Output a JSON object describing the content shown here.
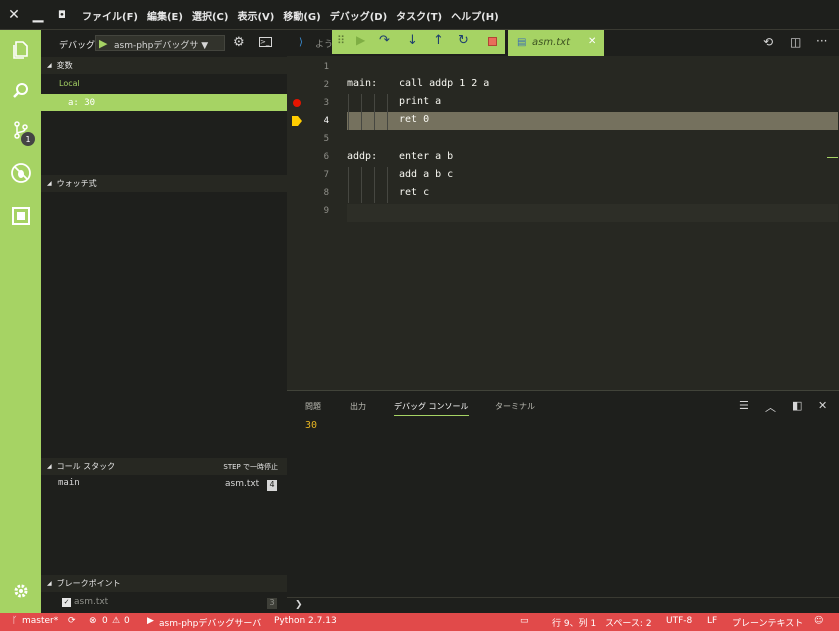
{
  "menu": [
    "ファイル(F)",
    "編集(E)",
    "選択(C)",
    "表示(V)",
    "移動(G)",
    "デバッグ(D)",
    "タスク(T)",
    "ヘルプ(H)"
  ],
  "activity": {
    "scm_badge": "1"
  },
  "debug_toolbar": {
    "label": "デバッグ",
    "config": "asm-phpデバッグサ ▼"
  },
  "variables": {
    "title": "変数",
    "scope": "Local",
    "items": [
      {
        "text": "a: 30"
      }
    ]
  },
  "watch": {
    "title": "ウォッチ式"
  },
  "callstack": {
    "title": "コール スタック",
    "status": "STEP で一時停止",
    "frame": {
      "name": "main",
      "file": "asm.txt",
      "line": "4"
    }
  },
  "breakpoints": {
    "title": "ブレークポイント",
    "item": {
      "file": "asm.txt",
      "line": "3"
    }
  },
  "tabs": [
    {
      "label": "よう"
    },
    {
      "label": "asm.txt"
    }
  ],
  "code": {
    "lines": [
      "1",
      "2",
      "3",
      "4",
      "5",
      "6",
      "7",
      "8",
      "9"
    ],
    "l2_label": "main:",
    "l2_code": "call addp 1 2 a",
    "l3_code": "print a",
    "l4_code": "ret 0",
    "l6_label": "addp:",
    "l6_code": "enter a b",
    "l7_code": "add a b c",
    "l8_code": "ret c"
  },
  "panel": {
    "tabs": [
      "問題",
      "出力",
      "デバッグ コンソール",
      "ターミナル"
    ],
    "output": "30",
    "prompt": "❯"
  },
  "status": {
    "branch": "master*",
    "errors": "0",
    "warnings": "0",
    "debug": "asm-phpデバッグサーバ",
    "python": "Python 2.7.13",
    "position": "行 9、列 1",
    "spaces": "スペース: 2",
    "encoding": "UTF-8",
    "eol": "LF",
    "language": "プレーンテキスト"
  },
  "colors": {
    "accent": "#a6d364",
    "statusbar": "#e14a4a",
    "highlight": "#75715e"
  }
}
